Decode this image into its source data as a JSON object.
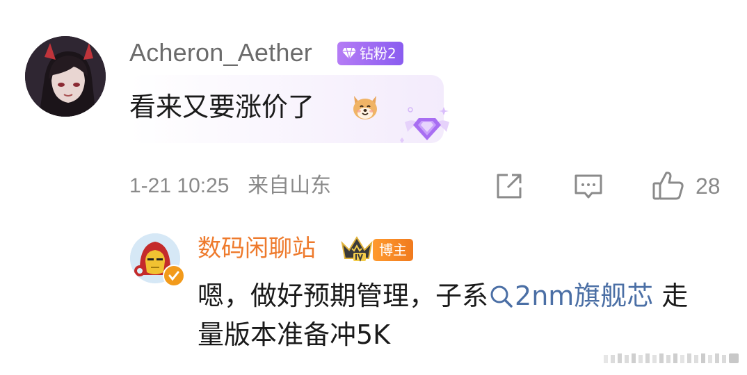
{
  "comment": {
    "username": "Acheron_Aether",
    "badge": "钻粉2",
    "text": "看来又要涨价了",
    "emoji": "dog-face-emoji",
    "timestamp": "1-21 10:25",
    "location": "来自山东",
    "like_count": "28",
    "actions": [
      "share-icon",
      "comment-icon",
      "like-icon"
    ]
  },
  "reply": {
    "username": "数码闲聊站",
    "badge": "博主",
    "text_prefix": "嗯，做好预期管理，子系",
    "topic": "2nm旗舰芯",
    "text_suffix": " 走量版本准备冲5K"
  },
  "colors": {
    "reply_username": "#ee7a2c",
    "topic_link": "#4b6fa5",
    "fan_badge": "#9c6cf2",
    "blogger_badge": "#f5862a",
    "meta_text": "#8a8a8a"
  }
}
